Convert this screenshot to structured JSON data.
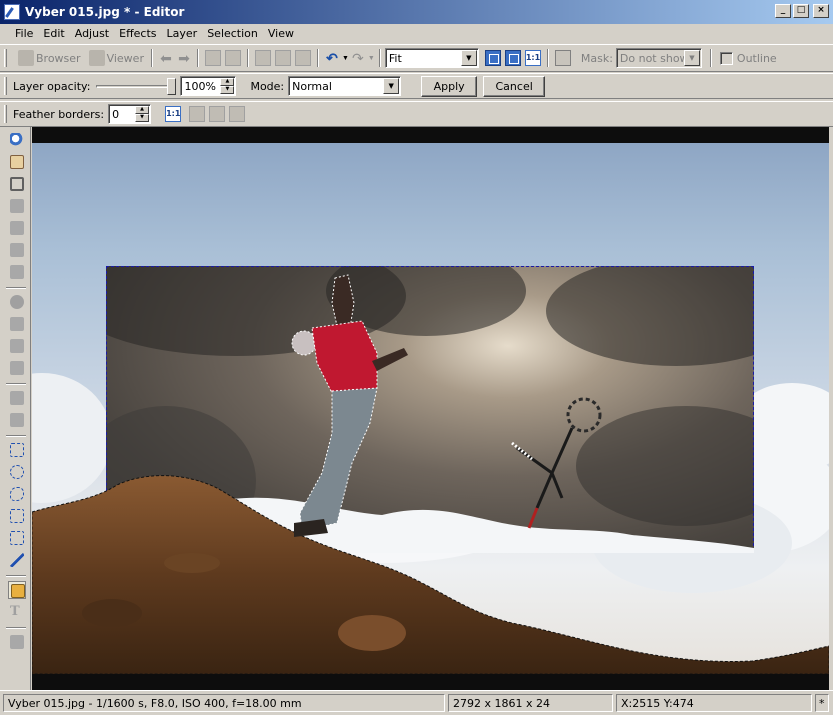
{
  "window": {
    "title": "Vyber 015.jpg * - Editor",
    "minimize": "_",
    "maximize": "□",
    "close": "×"
  },
  "menu": {
    "items": [
      {
        "label": "File",
        "key": "F"
      },
      {
        "label": "Edit",
        "key": "E"
      },
      {
        "label": "Adjust",
        "key": "A"
      },
      {
        "label": "Effects",
        "key": "E"
      },
      {
        "label": "Layer",
        "key": "L"
      },
      {
        "label": "Selection",
        "key": "S"
      },
      {
        "label": "View",
        "key": "V"
      }
    ]
  },
  "toolbar1": {
    "browser_label": "Browser",
    "viewer_label": "Viewer",
    "zoom_value": "Fit",
    "mask_label": "Mask:",
    "mask_value": "Do not show",
    "outline_label": "Outline",
    "one_to_one": "1:1"
  },
  "toolbar2": {
    "opacity_label": "Layer opacity:",
    "opacity_value": "100%",
    "opacity_level": 1.0,
    "mode_label": "Mode:",
    "mode_value": "Normal",
    "apply_label": "Apply",
    "cancel_label": "Cancel"
  },
  "toolbar3": {
    "feather_label": "Feather borders:",
    "feather_value": "0",
    "one_to_one": "1:1"
  },
  "status": {
    "file_info": "Vyber 015.jpg - 1/1600 s, F8.0, ISO 400, f=18.00 mm",
    "dimensions": "2792 x 1861 x 24",
    "coords": "X:2515  Y:474",
    "modified": "*"
  },
  "colors": {
    "title_start": "#0a246a",
    "title_end": "#a6caf0",
    "face": "#d4d0c8",
    "selection": "#1a1aa8"
  }
}
